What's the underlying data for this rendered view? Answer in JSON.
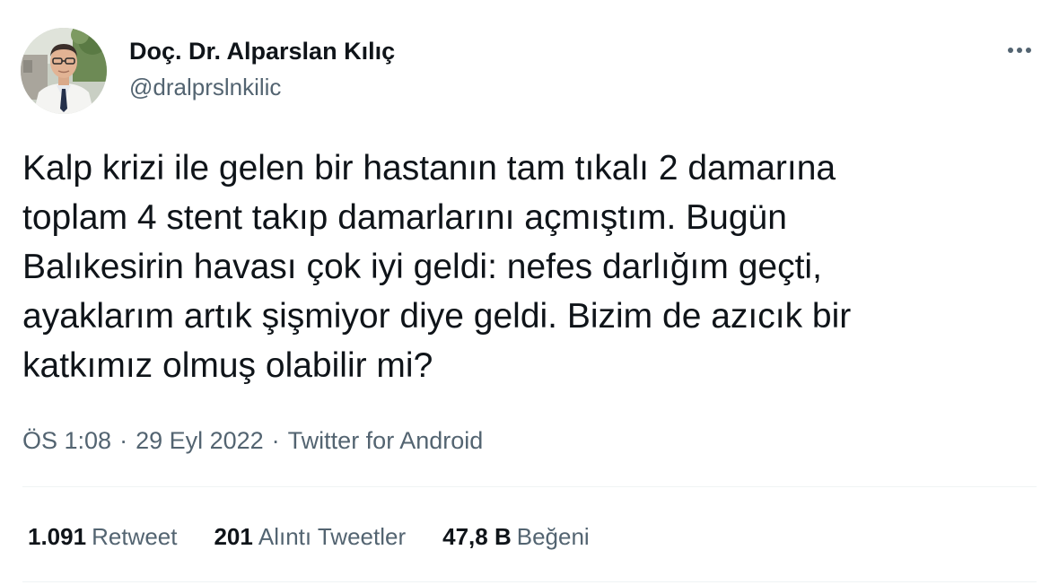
{
  "author": {
    "display_name": "Doç. Dr. Alparslan Kılıç",
    "handle": "@dralprslnkilic",
    "avatar_icon": "profile-photo"
  },
  "more_icon": "ellipsis-icon",
  "tweet": {
    "text": "Kalp krizi ile gelen bir hastanın tam tıkalı 2 damarına\ntoplam 4 stent takıp damarlarını açmıştım. Bugün\nBalıkesirin havası çok iyi geldi: nefes darlığım geçti,\nayaklarım artık şişmiyor diye geldi. Bizim de azıcık bir\nkatkımız olmuş olabilir mi?"
  },
  "meta": {
    "time": "ÖS 1:08",
    "separator": "·",
    "date": "29 Eyl 2022",
    "source": "Twitter for Android"
  },
  "stats": {
    "retweets": {
      "value": "1.091",
      "label": "Retweet"
    },
    "quotes": {
      "value": "201",
      "label": "Alıntı Tweetler"
    },
    "likes": {
      "value": "47,8 B",
      "label": "Beğeni"
    }
  },
  "colors": {
    "text_primary": "#0f1419",
    "text_secondary": "#536471",
    "divider": "#eff3f4"
  }
}
